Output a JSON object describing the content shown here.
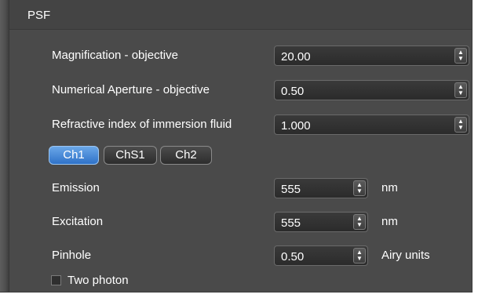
{
  "header": {
    "title": "PSF"
  },
  "fields": {
    "magnification": {
      "label": "Magnification - objective",
      "value": "20.00"
    },
    "numerical_aperture": {
      "label": "Numerical Aperture - objective",
      "value": "0.50"
    },
    "refractive_index": {
      "label": "Refractive index of immersion fluid",
      "value": "1.000"
    }
  },
  "channels": [
    {
      "label": "Ch1",
      "selected": true
    },
    {
      "label": "ChS1",
      "selected": false
    },
    {
      "label": "Ch2",
      "selected": false
    }
  ],
  "wavelengths": {
    "emission": {
      "label": "Emission",
      "value": "555",
      "unit": "nm"
    },
    "excitation": {
      "label": "Excitation",
      "value": "555",
      "unit": "nm"
    },
    "pinhole": {
      "label": "Pinhole",
      "value": "0.50",
      "unit": "Airy units"
    }
  },
  "two_photon": {
    "label": "Two photon",
    "checked": false
  },
  "icons": {
    "spin_arrows": "up-down-spinner-icon"
  },
  "colors": {
    "panel": "#4a4a4a",
    "active_channel": "#3f86d8"
  }
}
